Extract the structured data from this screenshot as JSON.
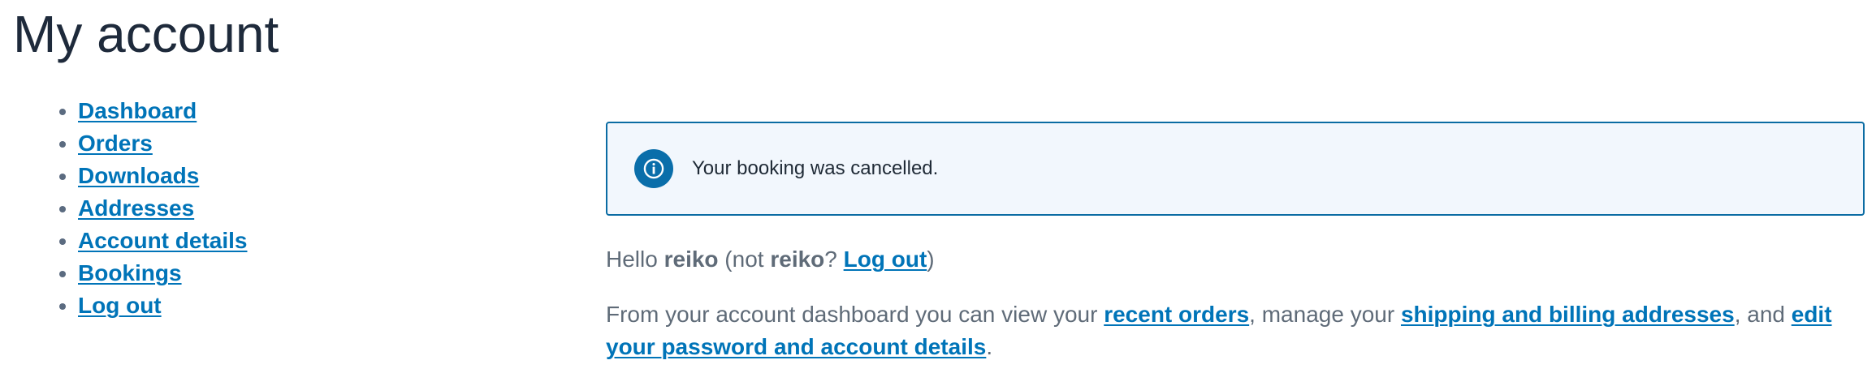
{
  "page": {
    "title": "My account"
  },
  "nav": {
    "items": [
      {
        "label": "Dashboard"
      },
      {
        "label": "Orders"
      },
      {
        "label": "Downloads"
      },
      {
        "label": "Addresses"
      },
      {
        "label": "Account details"
      },
      {
        "label": "Bookings"
      },
      {
        "label": "Log out"
      }
    ]
  },
  "notice": {
    "icon": "info-icon",
    "text": "Your booking was cancelled."
  },
  "greeting": {
    "hello": "Hello ",
    "username": "reiko",
    "not_open": " (not ",
    "username_repeat": "reiko",
    "question": "? ",
    "logout_link": "Log out",
    "close": ")"
  },
  "dashboard": {
    "intro": "From your account dashboard you can view your ",
    "recent_orders_link": "recent orders",
    "mid1": ", manage your ",
    "addresses_link": "shipping and billing addresses",
    "mid2": ", and ",
    "account_details_link": "edit your password and account details",
    "end": "."
  },
  "colors": {
    "title": "#1e2a3b",
    "link": "#0074b8",
    "notice_border": "#0b6ca3",
    "notice_bg": "#f2f7fd",
    "body_text": "#5f6b78"
  }
}
